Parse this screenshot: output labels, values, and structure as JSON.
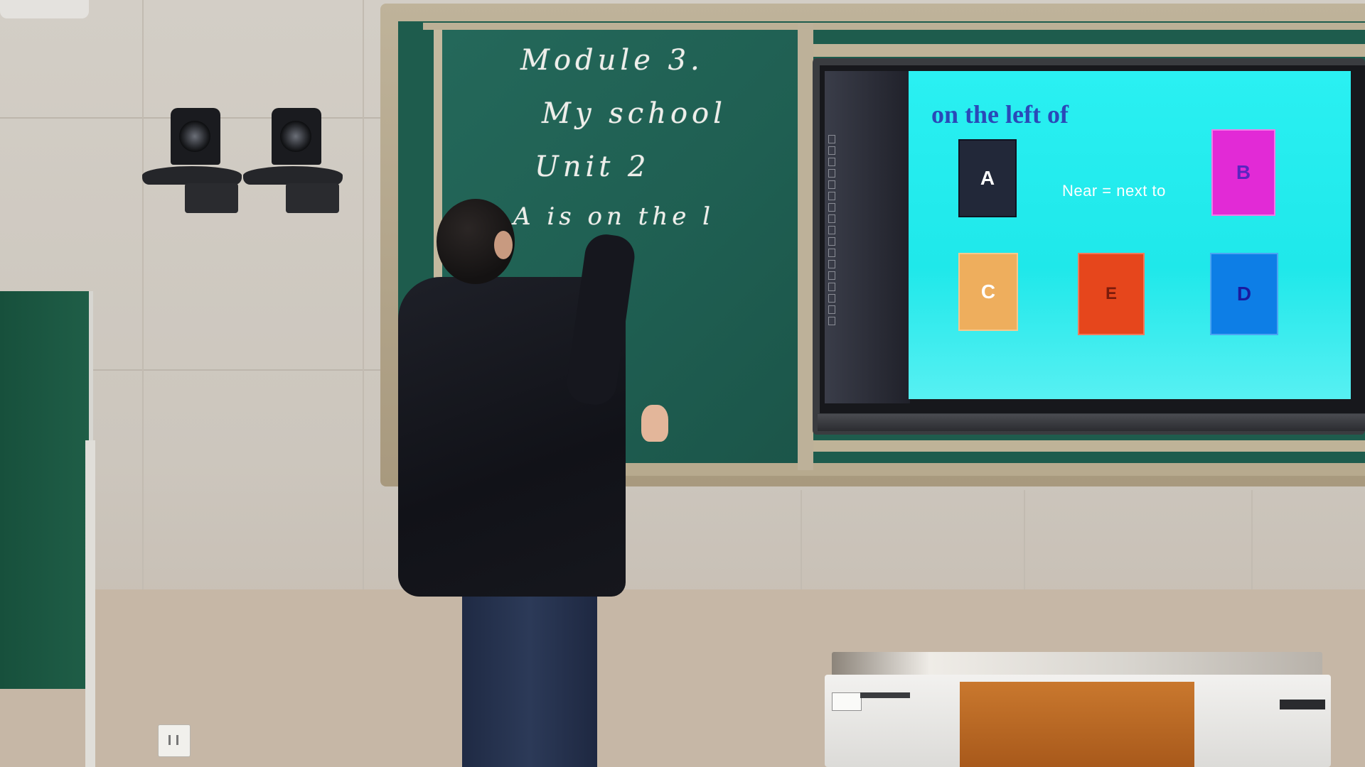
{
  "scene": {
    "type": "classroom",
    "subject": "teacher writing on chalkboard next to interactive display"
  },
  "chalkboard": {
    "lines": [
      "Module 3.",
      "My school",
      "Unit 2",
      "A is on the l"
    ]
  },
  "slide": {
    "title": "on the left of",
    "phrase": "Near  =  next to",
    "cards": [
      {
        "label": "A",
        "color": "#222839"
      },
      {
        "label": "B",
        "color": "#e22ad6"
      },
      {
        "label": "C",
        "color": "#eeae5d"
      },
      {
        "label": "E",
        "color": "#e6461c"
      },
      {
        "label": "D",
        "color": "#0d7ee6"
      }
    ],
    "background": "#2af0f2"
  },
  "colors": {
    "chalkboard": "#1f5f52",
    "frame": "#bfb39a",
    "wall": "#d3cec6"
  }
}
